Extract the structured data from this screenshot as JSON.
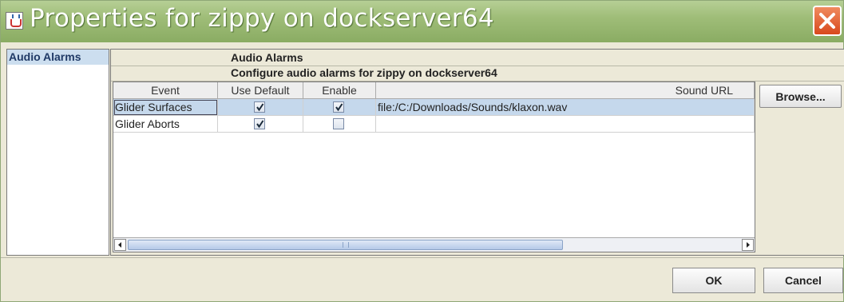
{
  "window": {
    "title": "Properties for zippy on dockserver64",
    "accent": "#9fbd78",
    "close_color": "#d8491d"
  },
  "sidebar": {
    "items": [
      {
        "label": "Audio Alarms",
        "selected": true
      }
    ]
  },
  "panel": {
    "title": "Audio Alarms",
    "subtitle": "Configure audio alarms for zippy on dockserver64"
  },
  "table": {
    "columns": [
      "Event",
      "Use Default",
      "Enable",
      "Sound URL"
    ],
    "rows": [
      {
        "event": "Glider Surfaces",
        "use_default": true,
        "enable": true,
        "sound_url": "file:/C:/Downloads/Sounds/klaxon.wav",
        "selected": true
      },
      {
        "event": "Glider Aborts",
        "use_default": true,
        "enable": false,
        "sound_url": "",
        "selected": false
      }
    ],
    "scroll_grip": "|||"
  },
  "buttons": {
    "browse": "Browse...",
    "ok": "OK",
    "cancel": "Cancel"
  },
  "icons": {
    "app": "java-icon",
    "close": "close-icon",
    "check": "checkmark-icon",
    "left_arrow": "scroll-left-icon",
    "right_arrow": "scroll-right-icon"
  }
}
